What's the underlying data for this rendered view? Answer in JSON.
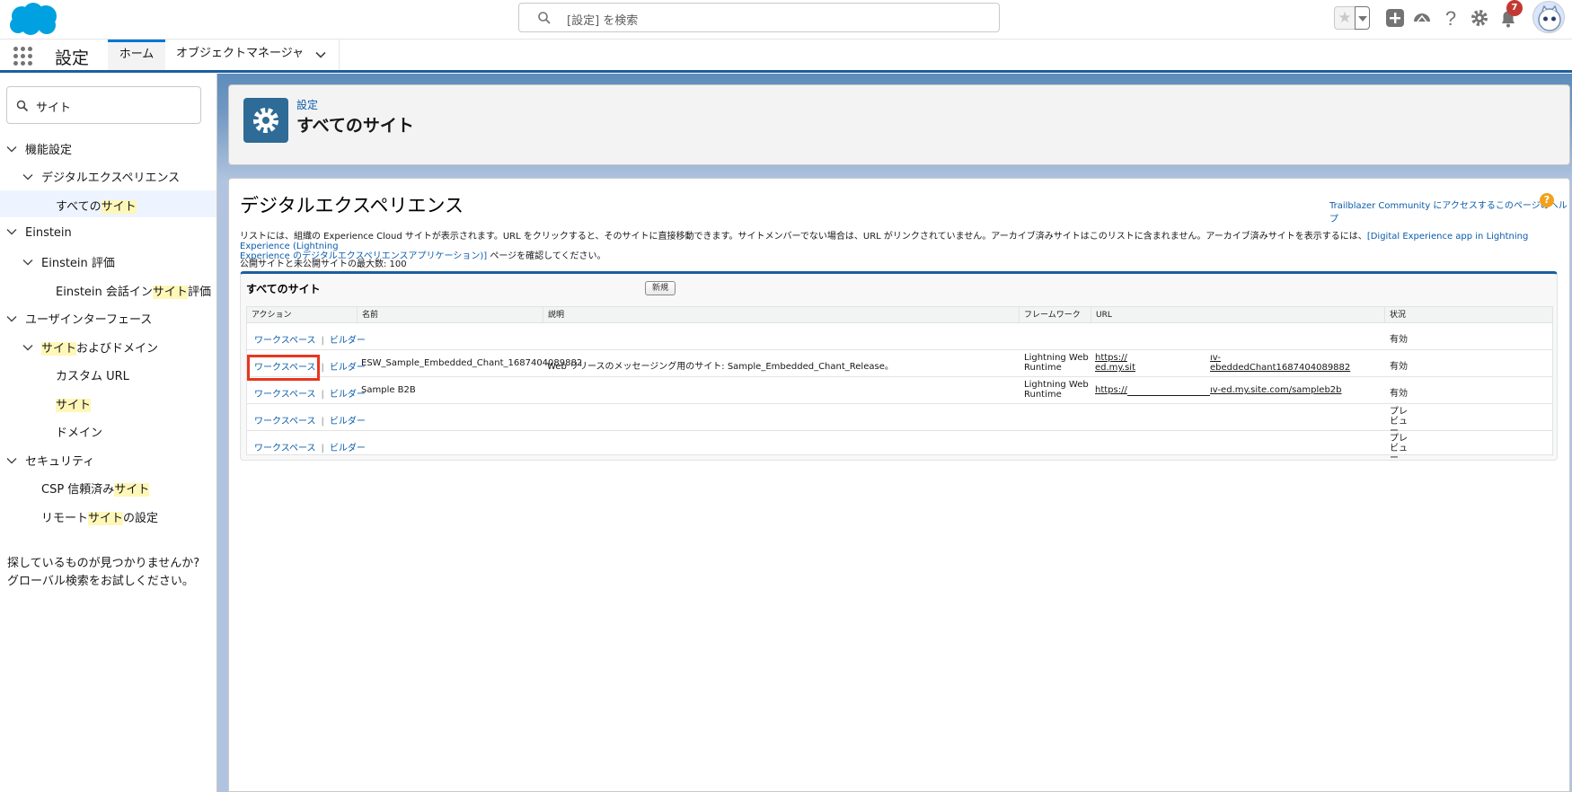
{
  "header": {
    "search_placeholder": "[設定] を検索",
    "notification_count": "7"
  },
  "context": {
    "app_name": "設定",
    "tab_home": "ホーム",
    "tab_object_manager": "オブジェクトマネージャ"
  },
  "sidebar": {
    "quick_find_value": "サイト",
    "items": [
      {
        "label": "機能設定"
      },
      {
        "label": "デジタルエクスペリエンス"
      },
      {
        "pre": "すべての",
        "hl": "サイト",
        "post": ""
      },
      {
        "label": "Einstein"
      },
      {
        "label": "Einstein 評価"
      },
      {
        "pre": "Einstein 会話イン",
        "hl": "サイト",
        "post": "評価"
      },
      {
        "label": "ユーザインターフェース"
      },
      {
        "pre": "",
        "hl": "サイト",
        "post": "およびドメイン"
      },
      {
        "label": "カスタム URL"
      },
      {
        "pre": "",
        "hl": "サイト",
        "post": ""
      },
      {
        "label": "ドメイン"
      },
      {
        "label": "セキュリティ"
      },
      {
        "pre": "CSP 信頼済み",
        "hl": "サイト",
        "post": ""
      },
      {
        "pre": "リモート",
        "hl": "サイト",
        "post": "の設定"
      }
    ],
    "help_line1": "探しているものが見つかりませんか?",
    "help_line2": "グローバル検索をお試しください。"
  },
  "page_header": {
    "breadcrumb": "設定",
    "title": "すべてのサイト"
  },
  "card": {
    "heading": "デジタルエクスペリエンス",
    "help_link": "Trailblazer Community にアクセスするこのページのヘルプ",
    "help_icon": "?",
    "desc_text": "リストには、組織の Experience Cloud サイトが表示されます。URL をクリックすると、そのサイトに直接移動できます。サイトメンバーでない場合は、URL がリンクされていません。アーカイブ済みサイトはこのリストに含まれません。アーカイブ済みサイトを表示するには、",
    "desc_link1": "[Digital Experience app in Lightning Experience (Lightning",
    "desc_link2": "Experience のデジタルエクスペリエンスアプリケーション)]",
    "desc_tail": " ページを確認してください。",
    "max_sites": "公開サイトと未公開サイトの最大数: 100",
    "list_title": "すべてのサイト",
    "new_button": "新規",
    "columns": [
      "アクション",
      "名前",
      "説明",
      "フレームワーク",
      "URL",
      "状況"
    ],
    "action_workspace": "ワークスペース",
    "action_sep": "|",
    "action_builder": "ビルダー",
    "rows": [
      {
        "name": "",
        "desc": "",
        "fw1": "",
        "fw2": "",
        "url1": "",
        "url2": "",
        "status": "有効"
      },
      {
        "name": "ESW_Sample_Embedded_Chant_1687404089882",
        "desc": "Web リリースのメッセージング用のサイト: Sample_Embedded_Chant_Release。",
        "fw1": "Lightning Web",
        "fw2": "Runtime",
        "url1": "https://",
        "url1b": "ed.my.sit",
        "url2": "ıv-",
        "url2b": "ebeddedChant1687404089882",
        "status": "有効"
      },
      {
        "name": "Sample B2B",
        "desc": "",
        "fw1": "Lightning Web",
        "fw2": "Runtime",
        "url1": "https://",
        "url2": "ıv-ed.my.site.com/sampleb2b",
        "status": "有効"
      },
      {
        "name": "",
        "desc": "",
        "fw1": "",
        "fw2": "",
        "url1": "",
        "url2": "",
        "status": "プレビュー"
      },
      {
        "name": "",
        "desc": "",
        "fw1": "",
        "fw2": "",
        "url1": "",
        "url2": "",
        "status": "プレビュー"
      }
    ]
  },
  "colors": {
    "accent": "#0176d3",
    "link": "#0b5cab",
    "highlight": "#fff7b8",
    "red_box": "#e8361e"
  }
}
